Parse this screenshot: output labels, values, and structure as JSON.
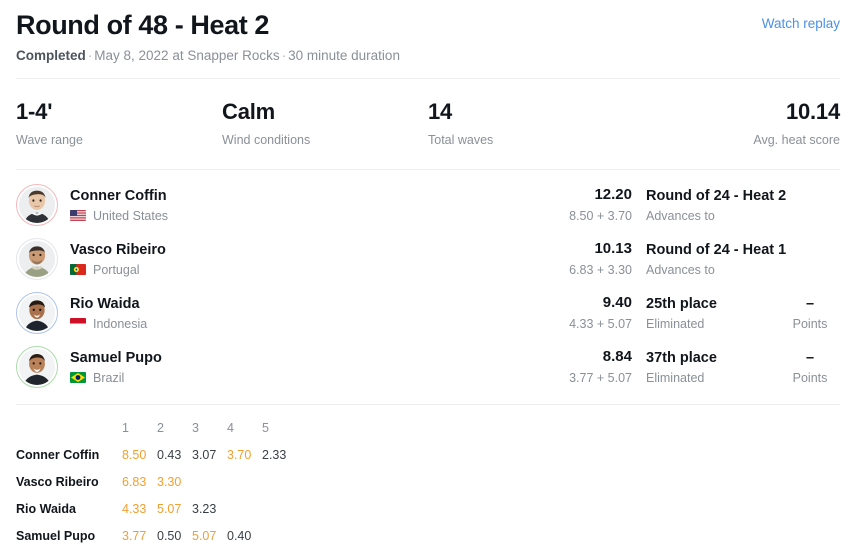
{
  "header": {
    "title": "Round of 48 - Heat 2",
    "status": "Completed",
    "meta": "May 8, 2022 at Snapper Rocks",
    "duration": "30 minute duration",
    "separator": "·",
    "watch_replay_label": "Watch replay",
    "link_color": "#4a90e8"
  },
  "stats": [
    {
      "value": "1-4'",
      "label": "Wave range"
    },
    {
      "value": "Calm",
      "label": "Wind conditions"
    },
    {
      "value": "14",
      "label": "Total waves"
    },
    {
      "value": "10.14",
      "label": "Avg. heat score"
    }
  ],
  "athletes": [
    {
      "name": "Conner Coffin",
      "country": "United States",
      "flag": "us-flag-icon",
      "jersey_color": "#f2b8bc",
      "total": "12.20",
      "breakdown": "8.50 + 3.70",
      "result": "Round of 24 - Heat 2",
      "result_sub": "Advances to",
      "points": "",
      "points_label": "",
      "show_points": false
    },
    {
      "name": "Vasco Ribeiro",
      "country": "Portugal",
      "flag": "pt-flag-icon",
      "jersey_color": "#e4e6e9",
      "total": "10.13",
      "breakdown": "6.83 + 3.30",
      "result": "Round of 24 - Heat 1",
      "result_sub": "Advances to",
      "points": "",
      "points_label": "",
      "show_points": false
    },
    {
      "name": "Rio Waida",
      "country": "Indonesia",
      "flag": "id-flag-icon",
      "jersey_color": "#aec4e8",
      "total": "9.40",
      "breakdown": "4.33 + 5.07",
      "result": "25th place",
      "result_sub": "Eliminated",
      "points": "–",
      "points_label": "Points",
      "show_points": true
    },
    {
      "name": "Samuel Pupo",
      "country": "Brazil",
      "flag": "br-flag-icon",
      "jersey_color": "#aadcaa",
      "total": "8.84",
      "breakdown": "3.77 + 5.07",
      "result": "37th place",
      "result_sub": "Eliminated",
      "points": "–",
      "points_label": "Points",
      "show_points": true
    }
  ],
  "wave_table": {
    "columns": [
      "1",
      "2",
      "3",
      "4",
      "5"
    ],
    "counted_color": "#f0a030",
    "rows": [
      {
        "name": "Conner Coffin",
        "waves": [
          {
            "score": "8.50",
            "counted": true
          },
          {
            "score": "0.43",
            "counted": false
          },
          {
            "score": "3.07",
            "counted": false
          },
          {
            "score": "3.70",
            "counted": true
          },
          {
            "score": "2.33",
            "counted": false
          }
        ]
      },
      {
        "name": "Vasco Ribeiro",
        "waves": [
          {
            "score": "6.83",
            "counted": true
          },
          {
            "score": "3.30",
            "counted": true
          }
        ]
      },
      {
        "name": "Rio Waida",
        "waves": [
          {
            "score": "4.33",
            "counted": true
          },
          {
            "score": "5.07",
            "counted": true
          },
          {
            "score": "3.23",
            "counted": false
          }
        ]
      },
      {
        "name": "Samuel Pupo",
        "waves": [
          {
            "score": "3.77",
            "counted": true
          },
          {
            "score": "0.50",
            "counted": false
          },
          {
            "score": "5.07",
            "counted": true
          },
          {
            "score": "0.40",
            "counted": false
          }
        ]
      }
    ]
  }
}
